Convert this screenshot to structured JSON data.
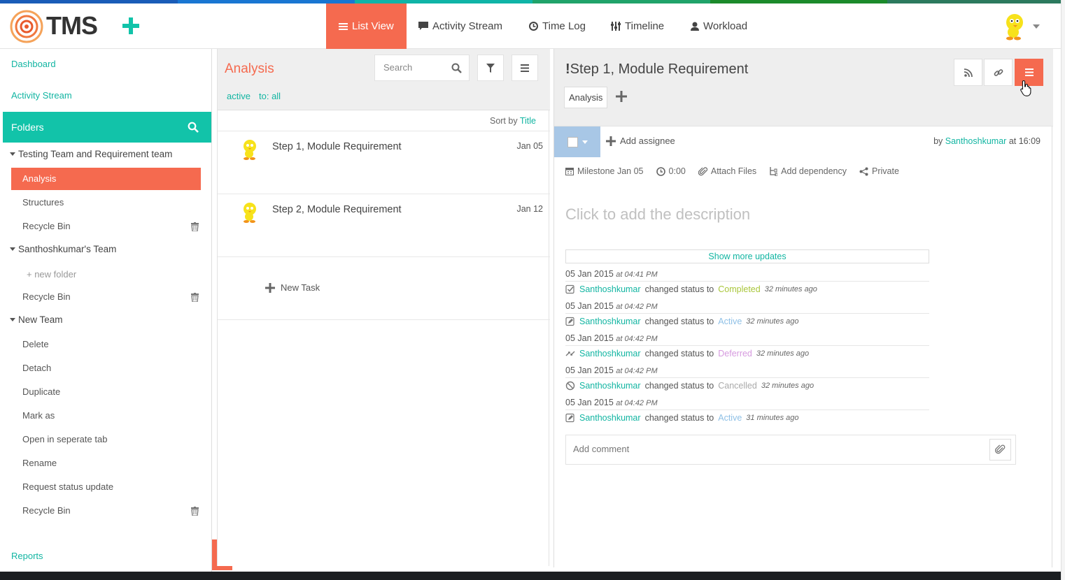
{
  "colors": {
    "stripe": [
      "#1a5cb8",
      "#1976d2",
      "#0fb4a7",
      "#20a36a",
      "#1b8a2b",
      "#2c7a5e"
    ],
    "accent": "#f56a4f",
    "teal": "#12c3a9",
    "completed": "#a9c63b",
    "active": "#8fc0e6",
    "deferred": "#d69adf",
    "cancelled": "#aaaaaa"
  },
  "app": {
    "logo_text": "TMS"
  },
  "nav": {
    "list_view": "List View",
    "activity_stream": "Activity Stream",
    "time_log": "Time Log",
    "timeline": "Timeline",
    "workload": "Workload"
  },
  "sidebar": {
    "dashboard": "Dashboard",
    "activity_stream": "Activity Stream",
    "folders": "Folders",
    "teams": [
      {
        "name": "Testing Team and Requirement team",
        "items": [
          "Analysis",
          "Structures",
          "Recycle Bin"
        ]
      },
      {
        "name": "Santhoshkumar's Team",
        "items": [
          "+ new folder",
          "Recycle Bin"
        ]
      },
      {
        "name": "New Team",
        "items": [
          "Delete",
          "Detach",
          "Duplicate",
          "Mark as",
          "Open in seperate tab",
          "Rename",
          "Request status update",
          "Recycle Bin"
        ]
      }
    ],
    "reports": "Reports"
  },
  "list": {
    "title": "Analysis",
    "search_placeholder": "Search",
    "filter_status": "active",
    "filter_to": "to: all",
    "sort_prefix": "Sort by",
    "sort_field": "Title",
    "tasks": [
      {
        "title": "Step 1, Module Requirement",
        "date": "Jan 05"
      },
      {
        "title": "Step 2, Module Requirement",
        "date": "Jan 12"
      }
    ],
    "new_task": "New Task"
  },
  "detail": {
    "title": "Step 1, Module Requirement",
    "folder_tag": "Analysis",
    "add_assignee": "Add assignee",
    "by_prefix": "by",
    "author": "Santhoshkumar",
    "at_time": "at 16:09",
    "milestone": "Milestone Jan 05",
    "time": "0:00",
    "attach_files": "Attach Files",
    "add_dependency": "Add dependency",
    "privacy": "Private",
    "description_placeholder": "Click to add the description",
    "show_more": "Show more updates",
    "updates": [
      {
        "date": "05 Jan 2015",
        "time": "at 04:41 PM",
        "user": "Santhoshkumar",
        "action": "changed status to",
        "status": "Completed",
        "ago": "32 minutes ago",
        "icon": "check-square-icon"
      },
      {
        "date": "05 Jan 2015",
        "time": "at 04:42 PM",
        "user": "Santhoshkumar",
        "action": "changed status to",
        "status": "Active",
        "ago": "32 minutes ago",
        "icon": "edit-square-icon"
      },
      {
        "date": "05 Jan 2015",
        "time": "at 04:42 PM",
        "user": "Santhoshkumar",
        "action": "changed status to",
        "status": "Deferred",
        "ago": "32 minutes ago",
        "icon": "deferred-arrows-icon"
      },
      {
        "date": "05 Jan 2015",
        "time": "at 04:42 PM",
        "user": "Santhoshkumar",
        "action": "changed status to",
        "status": "Cancelled",
        "ago": "32 minutes ago",
        "icon": "ban-icon"
      },
      {
        "date": "05 Jan 2015",
        "time": "at 04:42 PM",
        "user": "Santhoshkumar",
        "action": "changed status to",
        "status": "Active",
        "ago": "31 minutes ago",
        "icon": "edit-square-icon"
      }
    ],
    "comment_placeholder": "Add comment"
  }
}
